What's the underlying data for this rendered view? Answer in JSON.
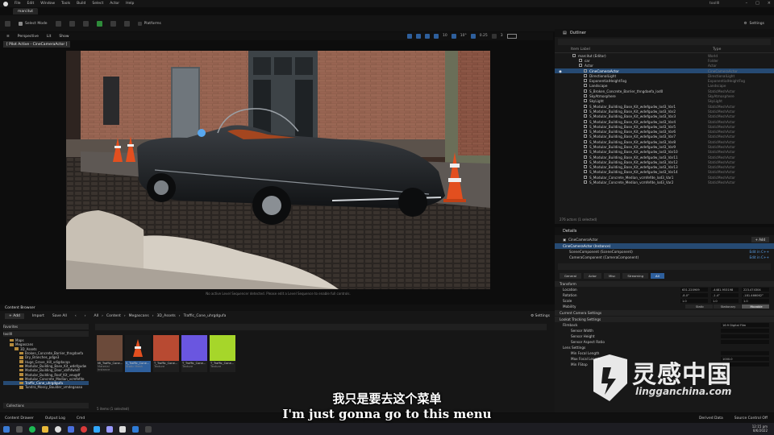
{
  "menu": {
    "items": [
      "File",
      "Edit",
      "Window",
      "Tools",
      "Build",
      "Select",
      "Actor",
      "Help"
    ],
    "project_label": "toolIII",
    "project_tab": "marcitut"
  },
  "toolbar": {
    "select_mode": "Select Mode",
    "platforms": "Platforms",
    "settings": "Settings"
  },
  "viewport": {
    "perspective": "Perspective",
    "lit": "Lit",
    "show": "Show",
    "pilot": "[ Pilot Active - CineCameraActor ]",
    "tool_values": [
      "10",
      "10°",
      "0.25",
      "3"
    ],
    "message": "No active Level Sequencer detected. Please edit a Level Sequence to enable full controls."
  },
  "outliner": {
    "title": "Outliner",
    "col_label": "Item Label",
    "col_type": "Type",
    "rows": [
      {
        "label": "marcitut (Editor)",
        "type": "World"
      },
      {
        "label": "car",
        "type": "Folder"
      },
      {
        "label": "Actor",
        "type": "Actor"
      },
      {
        "label": "CineCameraActor",
        "type": "CineCameraActor"
      },
      {
        "label": "DirectionalLight",
        "type": "DirectionalLight"
      },
      {
        "label": "ExponentialHeightFog",
        "type": "ExponentialHeightFog"
      },
      {
        "label": "Landscape",
        "type": "Landscape"
      },
      {
        "label": "S_Broken_Concrete_Barrier_thngdaefa_lod0",
        "type": "StaticMeshActor"
      },
      {
        "label": "SkyAtmosphere",
        "type": "SkyAtmosphere"
      },
      {
        "label": "SkyLight",
        "type": "SkyLight"
      },
      {
        "label": "S_Modular_Building_Base_Kit_wdefgudw_lod3_Var1",
        "type": "StaticMeshActor"
      },
      {
        "label": "S_Modular_Building_Base_Kit_wdefgudw_lod3_Var2",
        "type": "StaticMeshActor"
      },
      {
        "label": "S_Modular_Building_Base_Kit_wdefgudw_lod3_Var3",
        "type": "StaticMeshActor"
      },
      {
        "label": "S_Modular_Building_Base_Kit_wdefgudw_lod3_Var4",
        "type": "StaticMeshActor"
      },
      {
        "label": "S_Modular_Building_Base_Kit_wdefgudw_lod3_Var5",
        "type": "StaticMeshActor"
      },
      {
        "label": "S_Modular_Building_Base_Kit_wdefgudw_lod3_Var6",
        "type": "StaticMeshActor"
      },
      {
        "label": "S_Modular_Building_Base_Kit_wdefgudw_lod3_Var7",
        "type": "StaticMeshActor"
      },
      {
        "label": "S_Modular_Building_Base_Kit_wdefgudw_lod3_Var8",
        "type": "StaticMeshActor"
      },
      {
        "label": "S_Modular_Building_Base_Kit_wdefgudw_lod3_Var9",
        "type": "StaticMeshActor"
      },
      {
        "label": "S_Modular_Building_Base_Kit_wdefgudw_lod3_Var10",
        "type": "StaticMeshActor"
      },
      {
        "label": "S_Modular_Building_Base_Kit_wdefgudw_lod3_Var11",
        "type": "StaticMeshActor"
      },
      {
        "label": "S_Modular_Building_Base_Kit_wdefgudw_lod3_Var12",
        "type": "StaticMeshActor"
      },
      {
        "label": "S_Modular_Building_Base_Kit_wdefgudw_lod3_Var13",
        "type": "StaticMeshActor"
      },
      {
        "label": "S_Modular_Building_Base_Kit_wdefgudw_lod3_Var14",
        "type": "StaticMeshActor"
      },
      {
        "label": "S_Modular_Concrete_Median_vcmfefde_lod3_Var1",
        "type": "StaticMeshActor"
      },
      {
        "label": "S_Modular_Concrete_Median_vcmfefde_lod3_Var2",
        "type": "StaticMeshActor"
      }
    ],
    "status": "276 actors (1 selected)"
  },
  "details": {
    "title": "Details",
    "actor": "CineCameraActor",
    "add": "+ Add",
    "components": [
      "CineCameraActor (Instance)",
      "SceneComponent (SceneComponent)",
      "CameraComponent (CameraComponent)"
    ],
    "edit_label": "Edit in C++",
    "filters": [
      "General",
      "Actor",
      "Misc",
      "Streaming",
      "All"
    ],
    "transform_header": "Transform",
    "location_label": "Location",
    "location_values": [
      "631.220909",
      "-4481.953198",
      "223.474304"
    ],
    "rotation_label": "Rotation",
    "rotation_values": [
      "-8.0°",
      "-1.4°",
      "-181.466062°"
    ],
    "scale_label": "Scale",
    "scale_values": [
      "1.0",
      "1.0",
      "1.0"
    ],
    "mobility_label": "Mobility",
    "mobility_options": [
      "Static",
      "Stationary",
      "Movable"
    ],
    "sections": [
      "Current Camera Settings",
      "Lookat Tracking Settings",
      "Filmback",
      "Lens Settings"
    ],
    "filmback_value": "16:9 Digital Film",
    "sensor_labels": [
      "Sensor Width",
      "Sensor Height",
      "Sensor Aspect Ratio"
    ],
    "lens_labels": [
      "Min Focal Length",
      "Max Focal Length",
      "Min FStop"
    ],
    "lens_values": [
      "",
      "1000.0",
      "1.2"
    ]
  },
  "content_browser": {
    "title": "Content Browser",
    "add": "+ Add",
    "import": "Import",
    "save_all": "Save All",
    "path": [
      "All",
      "Content",
      "Megascans",
      "3D_Assets",
      "Traffic_Cone_uhrgdgufa"
    ],
    "settings": "Settings",
    "favorites": "Favorites",
    "project": "toolIII",
    "tree": [
      "Maps",
      "Megascans",
      "3D_Assets",
      "Broken_Concrete_Barrier_thngdaefa",
      "Dry_Branches_pdge3",
      "Huge_Grave_Hill_vdigdacqa",
      "Modular_Building_Base_Kit_wdefgudw",
      "Modular_Building_Door_vbfhfwhdf",
      "Modular_Building_Roof_Kit_veugdf",
      "Modular_Concrete_Median_vcmfefde",
      "Traffic_Cone_uhrgdgufa",
      "Tundra_Mossy_Boulder_vmdegaaaa"
    ],
    "collections": "Collections",
    "assets": [
      {
        "name": "MI_Traffic_Cone...",
        "type": "Material Instance",
        "color": "#6b4a3a"
      },
      {
        "name": "S_Traffic_Cone...",
        "type": "Static Mesh",
        "color": "#1a1a1a"
      },
      {
        "name": "T_Traffic_Cone...",
        "type": "Texture",
        "color": "#b84a32"
      },
      {
        "name": "T_Traffic_Cone...",
        "type": "Texture",
        "color": "#6a56e0"
      },
      {
        "name": "T_Traffic_Cone...",
        "type": "Texture",
        "color": "#a6d62a"
      }
    ],
    "count": "5 items (1 selected)"
  },
  "statusbar": {
    "items": [
      "Content Drawer",
      "Output Log",
      "Cmd"
    ],
    "right": [
      "Derived Data",
      "Source Control Off"
    ]
  },
  "taskbar": {
    "time": "12:15 pm",
    "date": "8/6/2022"
  },
  "subtitles": {
    "cn": "我只是要去这个菜单",
    "en": "I'm just gonna go to this menu"
  },
  "watermark": {
    "cn": "灵感中国",
    "en": "lingganchina.com"
  }
}
